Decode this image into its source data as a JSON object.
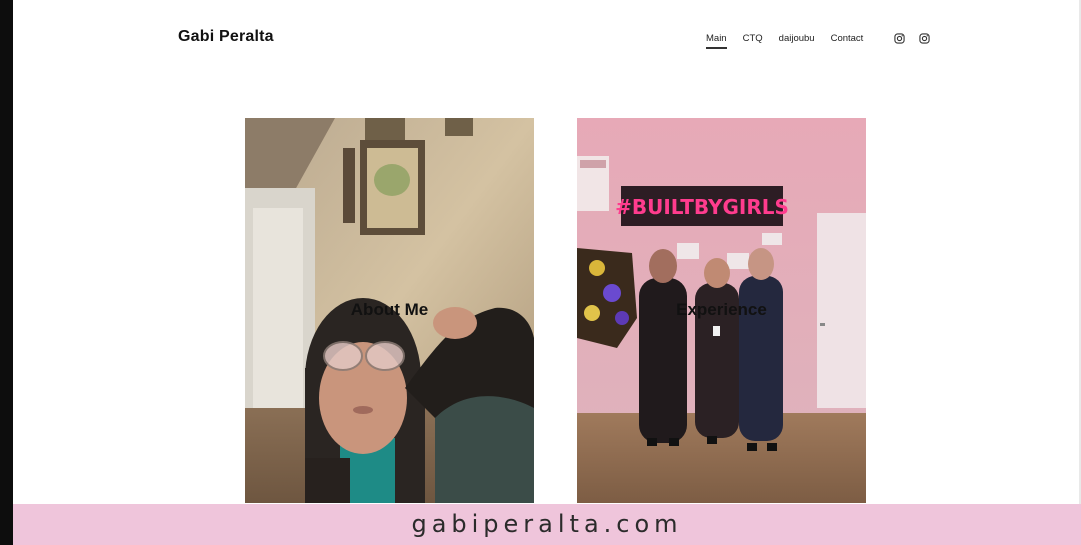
{
  "header": {
    "site_title": "Gabi Peralta",
    "nav": [
      {
        "label": "Main",
        "active": true
      },
      {
        "label": "CTQ",
        "active": false
      },
      {
        "label": "daijoubu",
        "active": false
      },
      {
        "label": "Contact",
        "active": false
      }
    ],
    "social_icons": [
      "instagram-icon",
      "instagram-icon"
    ]
  },
  "cards": [
    {
      "label": "About Me"
    },
    {
      "label": "Experience",
      "sign_text": "#BUILTBYGIRLS"
    }
  ],
  "footer": {
    "url": "gabiperalta.com"
  },
  "colors": {
    "banner": "#efc5db",
    "neon": "#ff3c8e",
    "left_bar": "#0d0d0d"
  }
}
